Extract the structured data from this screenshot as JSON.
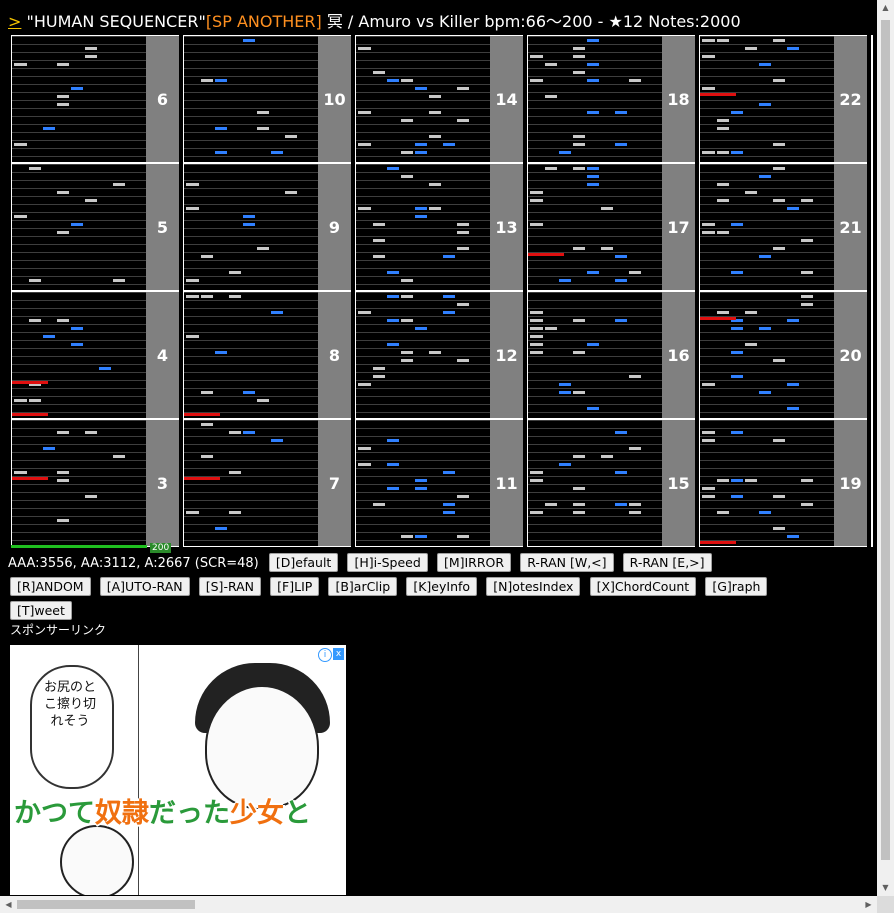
{
  "title": {
    "arrow": ">",
    "song": "\"HUMAN SEQUENCER\"",
    "difficulty": "[SP ANOTHER]",
    "rest": " 冥 / Amuro vs Killer bpm:66～200 - ★12 Notes:2000"
  },
  "colors": {
    "white_note": "#c8c8c8",
    "blue_note": "#3080ff",
    "red_note": "#e01010",
    "scratch_lane": "#808080"
  },
  "chart": {
    "columns": [
      {
        "measures": [
          "6",
          "5",
          "4",
          "3"
        ]
      },
      {
        "measures": [
          "10",
          "9",
          "8",
          "7"
        ]
      },
      {
        "measures": [
          "14",
          "13",
          "12",
          "11"
        ]
      },
      {
        "measures": [
          "18",
          "17",
          "16",
          "15"
        ]
      },
      {
        "measures": [
          "22",
          "21",
          "20",
          "19"
        ]
      }
    ]
  },
  "bpm_marker": "200",
  "score_line": "AAA:3556, AA:3112, A:2667 (SCR=48)",
  "buttons": [
    "[D]efault",
    "[H]i-Speed",
    "[M]IRROR",
    "R-RAN [W,<]",
    "R-RAN [E,>]",
    "[R]ANDOM",
    "[A]UTO-RAN",
    "[S]-RAN",
    "[F]LIP",
    "[B]arClip",
    "[K]eyInfo",
    "[N]otesIndex",
    "[X]ChordCount",
    "[G]raph",
    "[T]weet"
  ],
  "sponsor_label": "スポンサーリンク",
  "ad": {
    "bubble_text": "お尻のとこ擦り切れそう",
    "catch_pre": "かつて",
    "catch_hl1": "奴隷",
    "catch_mid": "だった",
    "catch_hl2": "少女",
    "catch_post": "と",
    "info_icon": "i",
    "close_icon": "x"
  }
}
